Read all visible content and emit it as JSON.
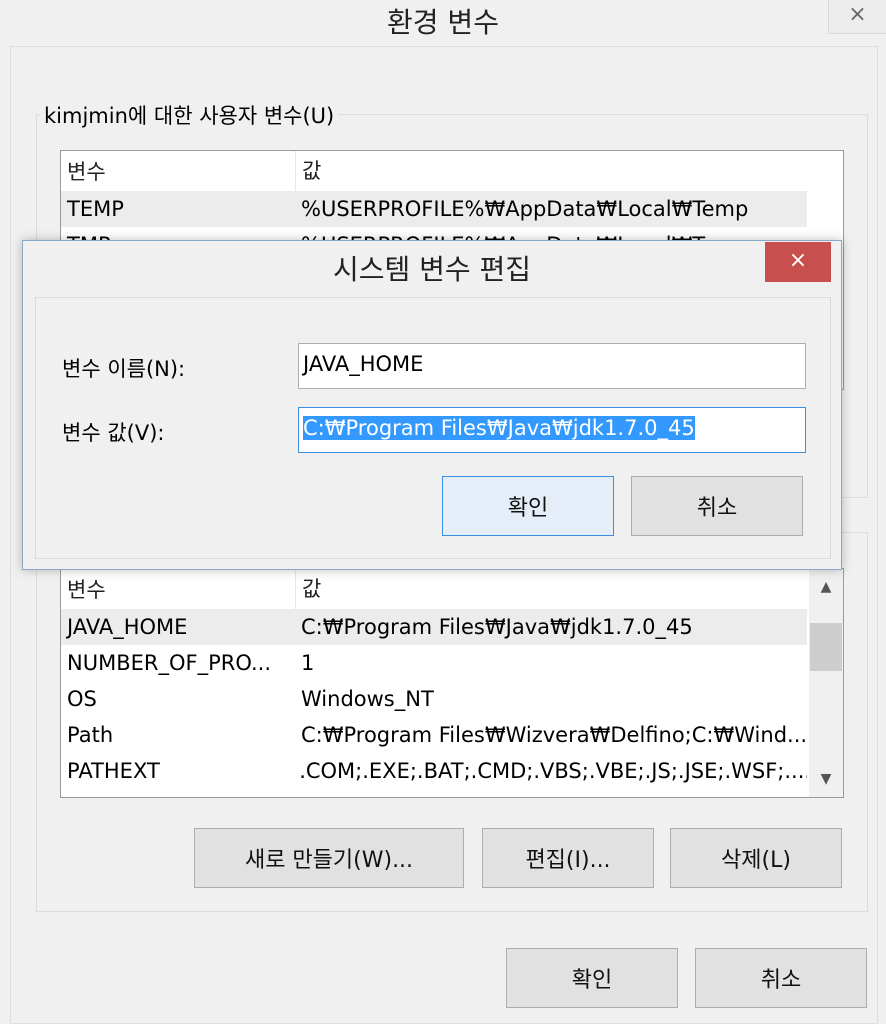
{
  "window": {
    "title": "환경 변수",
    "close_glyph": "×"
  },
  "user_vars": {
    "group_label": "kimjmin에 대한 사용자 변수(U)",
    "columns": [
      "변수",
      "값"
    ],
    "rows": [
      {
        "name": "TEMP",
        "value": "%USERPROFILE%₩AppData₩Local₩Temp"
      },
      {
        "name": "TMP",
        "value": "%USERPROFILE%₩AppData₩Local₩Temp"
      }
    ]
  },
  "system_vars": {
    "columns": [
      "변수",
      "값"
    ],
    "rows": [
      {
        "name": "JAVA_HOME",
        "value": "C:₩Program Files₩Java₩jdk1.7.0_45"
      },
      {
        "name": "NUMBER_OF_PRO...",
        "value": "1"
      },
      {
        "name": "OS",
        "value": "Windows_NT"
      },
      {
        "name": "Path",
        "value": "C:₩Program Files₩Wizvera₩Delfino;C:₩Wind..."
      },
      {
        "name": "PATHEXT",
        "value": ".COM;.EXE;.BAT;.CMD;.VBS;.VBE;.JS;.JSE;.WSF;...."
      }
    ],
    "scroll_up_icon": "▲",
    "scroll_down_icon": "▼",
    "buttons": {
      "new": "새로 만들기(W)...",
      "edit": "편집(I)...",
      "delete": "삭제(L)"
    }
  },
  "footer": {
    "ok": "확인",
    "cancel": "취소"
  },
  "dialog": {
    "title": "시스템 변수 편집",
    "close_glyph": "×",
    "name_label": "변수 이름(N):",
    "name_value": "JAVA_HOME",
    "value_label": "변수 값(V):",
    "value_value": "C:₩Program Files₩Java₩jdk1.7.0_45",
    "ok": "확인",
    "cancel": "취소"
  },
  "colors": {
    "accent": "#3c8ee0",
    "close_red": "#c7504f",
    "selection": "#3399ff"
  }
}
